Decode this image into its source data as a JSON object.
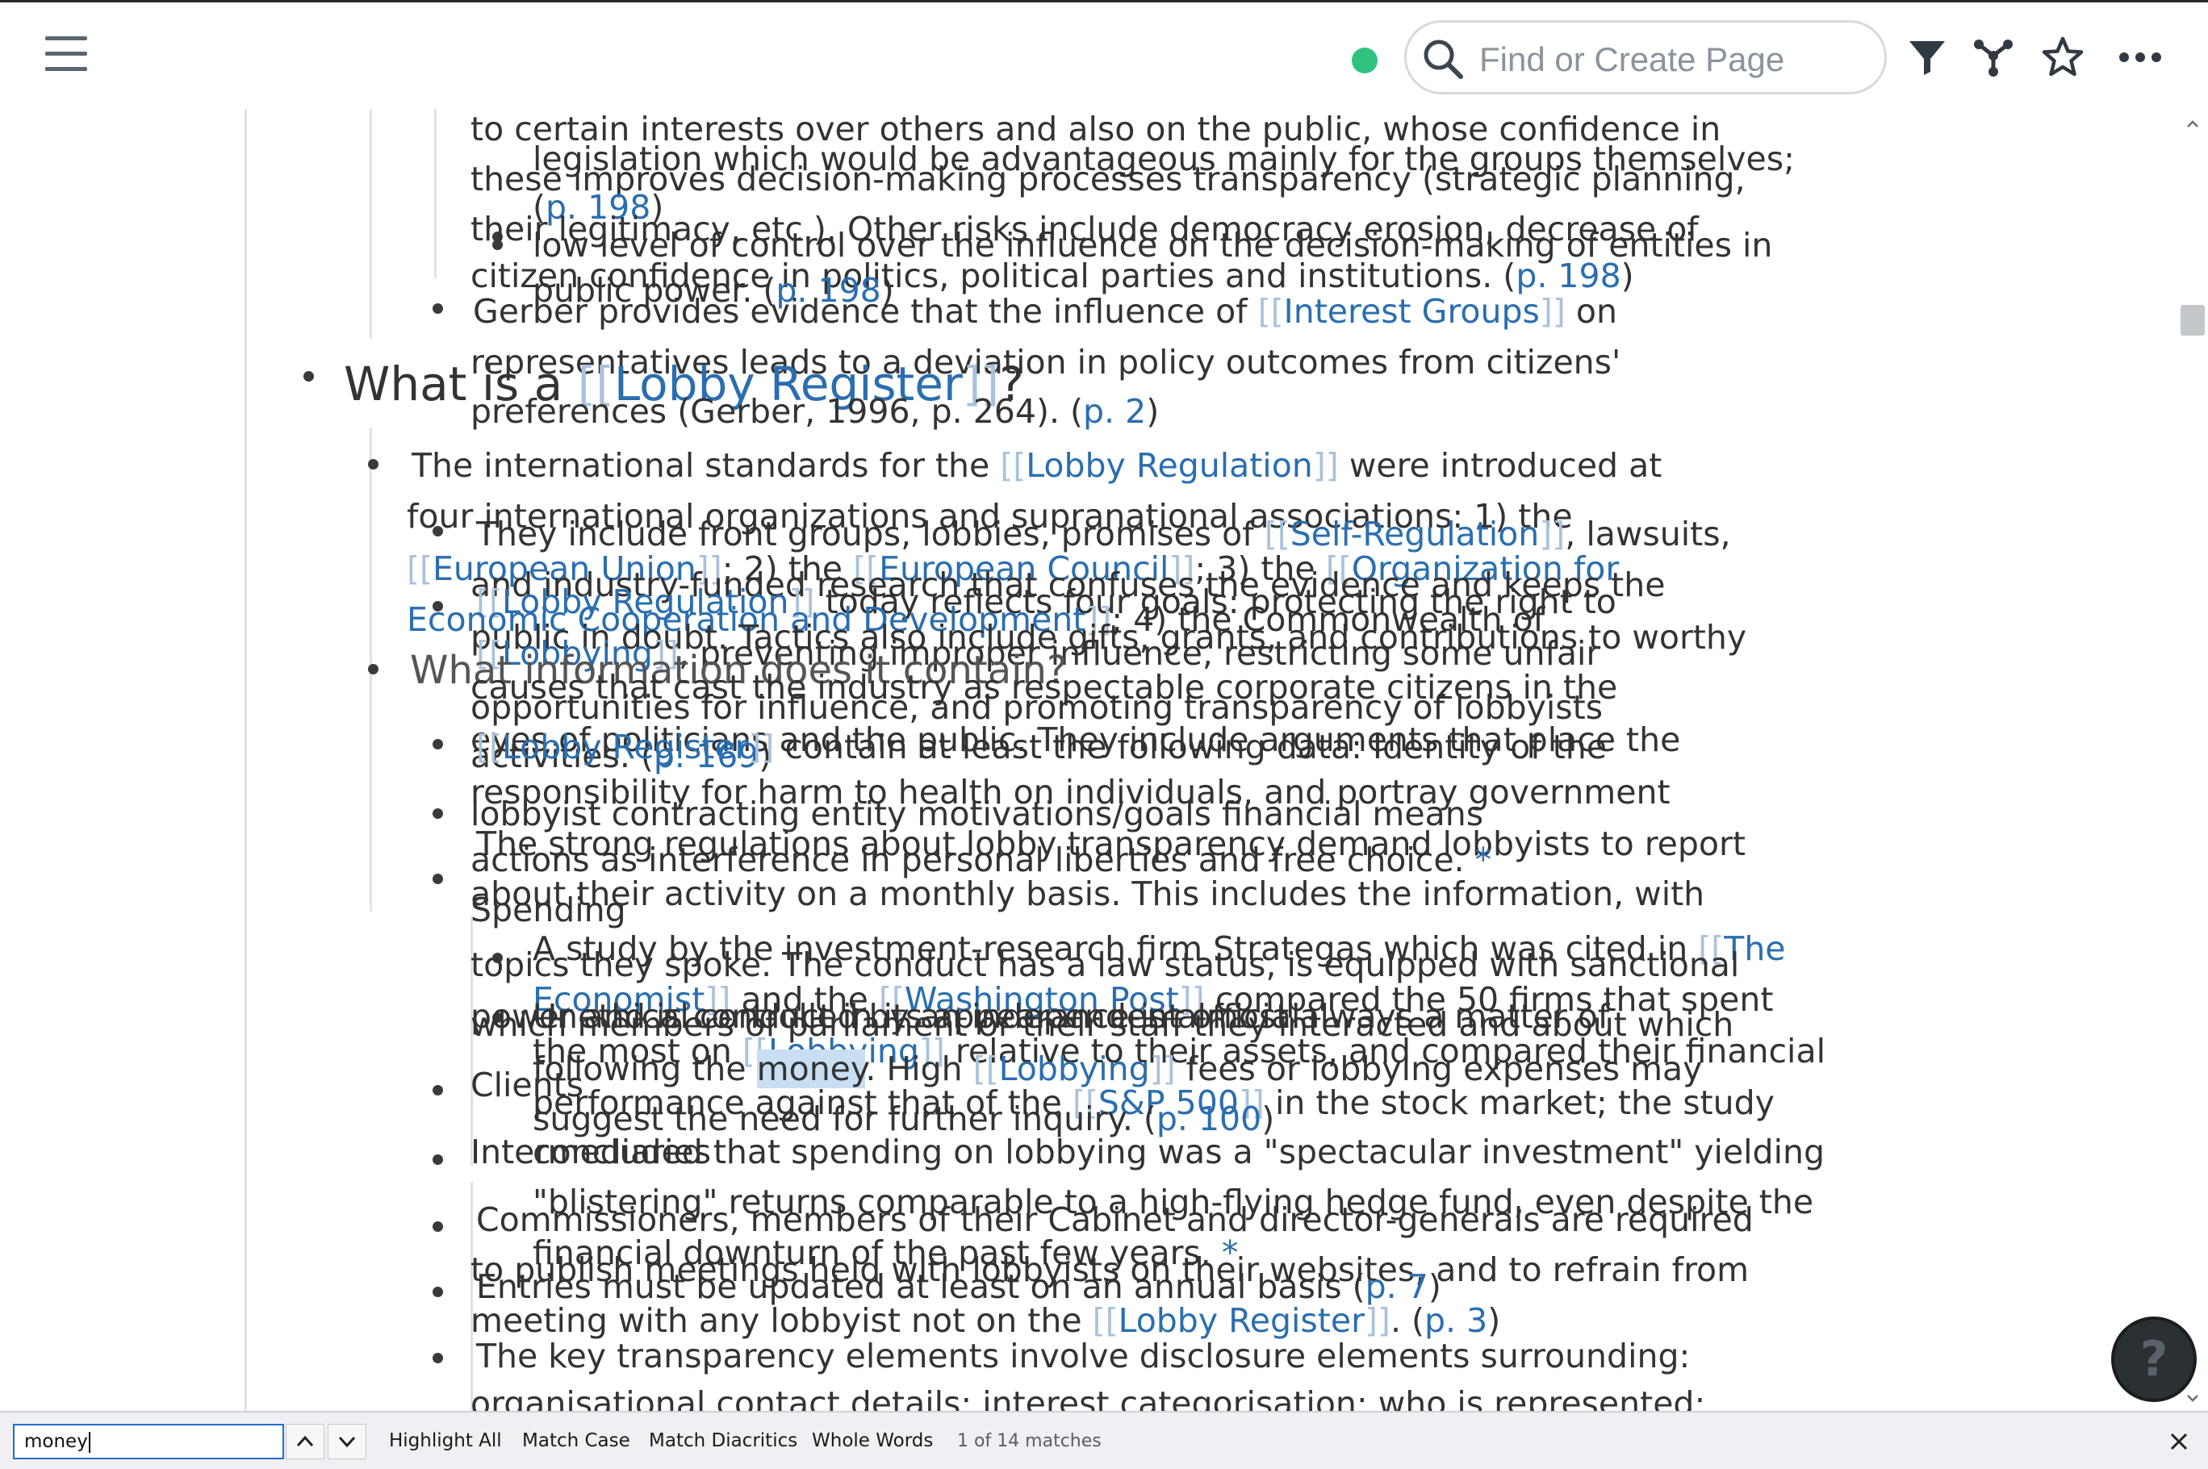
{
  "topbar": {
    "search_placeholder": "Find or Create Page",
    "icons": [
      "menu-icon",
      "sync-status-dot",
      "search-icon",
      "filter-icon",
      "graph-icon",
      "star-icon",
      "more-icon"
    ]
  },
  "text": {
    "l01a": "to certain interests over others and also on the public, whose confidence in",
    "l01b": "legislation which would be advantageous mainly for the groups themselves;",
    "l02a": "these improves decision-making processes transparency (strategic planning,",
    "l02b": "(",
    "l02c": "p. 198",
    "l02d": ")",
    "l03a": "their legitimacy, etc.). Other risks include democracy erosion, decrease of",
    "l03b": "low level of control over the influence on the decision-making of entities in",
    "l04a": "citizen confidence in politics, political parties and institutions. (",
    "l04b": "p. 198",
    "l04c": ")",
    "l04d": "public power. (",
    "l04e": "p. 198",
    "l04f": ")",
    "l05a": "Gerber provides evidence that the influence of ",
    "l05b": "Interest Groups",
    "l05c": " on",
    "l06": "representatives leads to a deviation in policy outcomes from citizens'",
    "h1a": "What is a ",
    "h1b": "Lobby Register",
    "h1c": "?",
    "l07": "preferences (Gerber, 1996, p. 264). (",
    "l07b": "p. 2",
    "l07c": ")",
    "l08a": "The international standards for the ",
    "l08b": "Lobby Regulation",
    "l08c": " were introduced at",
    "l09": "four international organizations and supranational associations: 1) the",
    "l10a": "They include front groups, lobbies, promises of ",
    "l10b": "Self-Regulation",
    "l10c": ", lawsuits,",
    "l11a": "European Union",
    "l11b": "; 2) the ",
    "l11c": "European Council",
    "l11d": "; 3) the ",
    "l11e": "Organization for",
    "l12": "and industry-funded research that confuses the evidence and keeps the",
    "l13a": "Lobby Regulation",
    "l13b": " today reflects four goals: protecting the right to",
    "l14a": "Economic Cooperation and Development",
    "l14b": "; 4) the Commonwealth of",
    "l15": "public in doubt. Tactics also include gifts, grants, and contributions to worthy",
    "l16a": "Lobbying",
    "l16b": ", preventing improper influence, restricting some unfair",
    "h2": "What information does it contain?",
    "l17": "causes that cast the industry as respectable corporate citizens in the",
    "l18": "opportunities for influence, and promoting transparency of lobbyists",
    "l19": "eyes of politicians and the public. They include arguments that place the",
    "l20a": "activities. (",
    "l20b": "p. 169",
    "l20c": ")",
    "l20d": "Lobby Register",
    "l20e": " contain at least the following data: Identity of the",
    "l21": "responsibility for harm to health on individuals, and portray government",
    "l22": "lobbyist contracting entity motivations/goals financial means",
    "l23": "The strong regulations about lobby transparency demand lobbyists to report",
    "l24": "actions as interference in personal liberties and free choice.",
    "star1": "*",
    "l25": "about their activity on a monthly basis. This includes the information, with",
    "l26": "Spending",
    "l27": "which members of parliament or their staff they interacted and about which",
    "l28a": "A study by the investment-research firm Strategas which was cited in ",
    "l28b": "The",
    "l29": "topics they spoke. The conduct has a law status, is equipped with sanctional",
    "l30a": "Economist",
    "l30b": " and the ",
    "l30c": "Washington Post",
    "l30d": " compared the 50 firms that spent",
    "l31": "power and is controlled by an independent official",
    "l31b": "Unethical conduct in its appearance is almost always a matter of",
    "l32a": "the most on ",
    "l32b": "Lobbying",
    "l32c": " relative to their assets, and compared their financial",
    "l33a": "following the ",
    "l33b": "money",
    "l33c": ". High ",
    "l33d": "Lobbying",
    "l33e": " fees or lobbying expenses may",
    "l34": "Clients",
    "l35a": "performance against that of the ",
    "l35b": "S&P 500",
    "l35c": " in the stock market; the study",
    "l36a": "suggest the need for further inquiry. (",
    "l36b": "p. 100",
    "l36c": ")",
    "l37": "Intermediaries",
    "l37b": "concluded that spending on lobbying was a \"spectacular investment\" yielding",
    "l38": "\"blistering\" returns comparable to a high-flying hedge fund, even despite the",
    "l39": "Commissioners, members of their Cabinet and director-generals are required",
    "l40": "financial downturn of the past few years.",
    "star2": "*",
    "l41": "to publish meetings held with lobbyists on their websites, and to refrain from",
    "l42a": "Entries must be updated at least on an annual basis (",
    "l42b": "p. 7",
    "l42c": ")",
    "l43a": "meeting with any lobbyist not on the ",
    "l43b": "Lobby Register",
    "l43c": ". (",
    "l43d": "p. 3",
    "l43e": ")",
    "l44": "The key transparency elements involve disclosure elements surrounding:",
    "l45": "organisational contact details; interest categorisation; who is represented;"
  },
  "help": {
    "label": "?"
  },
  "findbar": {
    "query": "money",
    "highlight_all": "Highlight All",
    "match_case": "Match Case",
    "match_diacritics": "Match Diacritics",
    "whole_words": "Whole Words",
    "status": "1 of 14 matches"
  }
}
